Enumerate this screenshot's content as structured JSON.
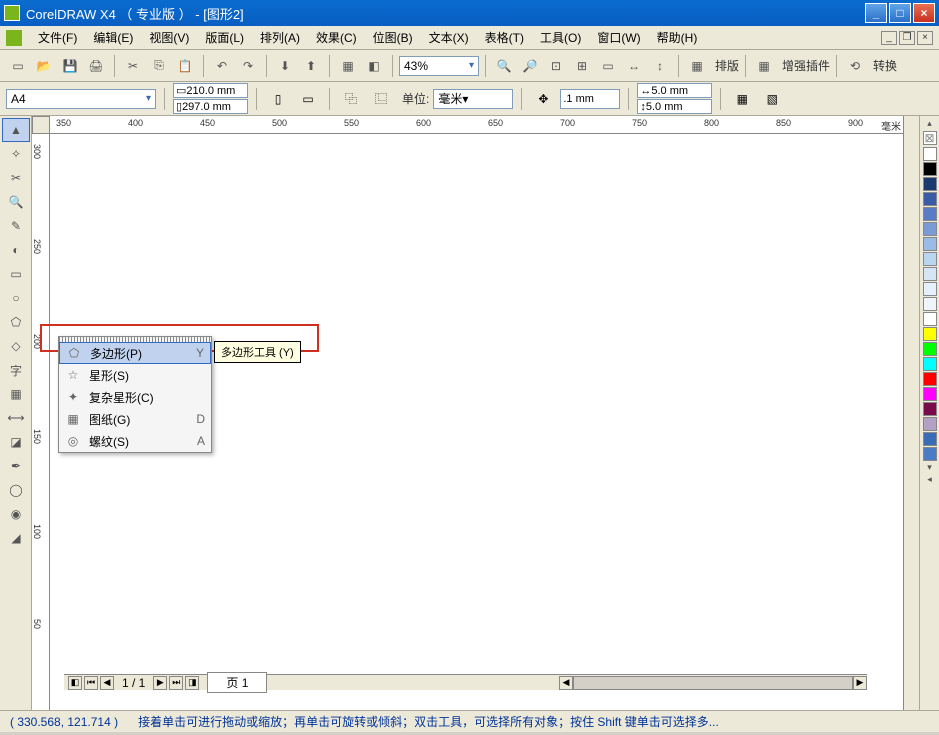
{
  "title": "CorelDRAW X4 （ 专业版 ） - [图形2]",
  "menu": {
    "file": "文件(F)",
    "edit": "编辑(E)",
    "view": "视图(V)",
    "layout": "版面(L)",
    "arrange": "排列(A)",
    "effects": "效果(C)",
    "bitmaps": "位图(B)",
    "text": "文本(X)",
    "table": "表格(T)",
    "tools": "工具(O)",
    "window": "窗口(W)",
    "help": "帮助(H)"
  },
  "toolbar": {
    "zoom_pct": "43%",
    "layout_label": "排版",
    "plugin_label": "增强插件",
    "transform_label": "转换"
  },
  "propbar": {
    "paper": "A4",
    "width": "210.0 mm",
    "height": "297.0 mm",
    "unit_label": "单位:",
    "unit": "毫米",
    "nudge": ".1 mm",
    "dup_x": "5.0 mm",
    "dup_y": "5.0 mm"
  },
  "ruler": {
    "h_ticks": [
      "350",
      "400",
      "450",
      "500",
      "550",
      "600",
      "650",
      "700",
      "750",
      "800",
      "850",
      "900"
    ],
    "h_unit": "毫米",
    "v_ticks": [
      "300",
      "250",
      "200",
      "150",
      "100",
      "50"
    ]
  },
  "flyout": {
    "tooltip": "多边形工具 (Y)",
    "items": [
      {
        "icon": "⬠",
        "label": "多边形(P)",
        "key": "Y"
      },
      {
        "icon": "☆",
        "label": "星形(S)",
        "key": ""
      },
      {
        "icon": "✦",
        "label": "复杂星形(C)",
        "key": ""
      },
      {
        "icon": "▦",
        "label": "图纸(G)",
        "key": "D"
      },
      {
        "icon": "◎",
        "label": "螺纹(S)",
        "key": "A"
      }
    ]
  },
  "colors": [
    "#ffffff",
    "#000000",
    "#1b3a6e",
    "#3a5ba5",
    "#5a7bc5",
    "#7a9bd5",
    "#9abbe5",
    "#bad5f0",
    "#d5e5f5",
    "#e5f0fa",
    "#f0f5fc",
    "#ffffff",
    "#ffff00",
    "#00ff00",
    "#00ffff",
    "#ff0000",
    "#ff00ff",
    "#7a0a4a",
    "#b5a0c5",
    "#3a6bb5",
    "#4a7bc5"
  ],
  "page": {
    "indicator": "1 / 1",
    "tab": "页 1"
  },
  "status": {
    "coords": "( 330.568, 121.714 )",
    "hint": "接着单击可进行拖动或缩放；再单击可旋转或倾斜；双击工具，可选择所有对象；按住 Shift 键单击可选择多..."
  }
}
